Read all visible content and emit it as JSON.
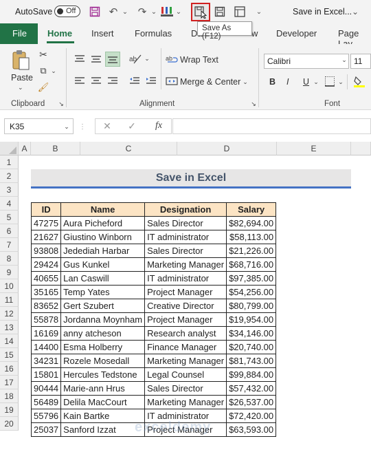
{
  "qat": {
    "autosave_label": "AutoSave",
    "autosave_state": "Off",
    "tooltip": "Save As (F12)",
    "doc_title": "Save in Excel...",
    "icons": [
      "save-icon",
      "undo-icon",
      "redo-icon",
      "paintbrush-icon",
      "save-as-icon",
      "save-icon",
      "print-layout-icon",
      "customize-icon"
    ]
  },
  "tabs": {
    "file": "File",
    "items": [
      "Home",
      "Insert",
      "Formulas",
      "Da",
      "w",
      "Developer",
      "Page Lay"
    ]
  },
  "ribbon": {
    "paste": "Paste",
    "clipboard": "Clipboard",
    "alignment": "Alignment",
    "font_group": "Font",
    "wrap_text": "Wrap Text",
    "merge_center": "Merge & Center",
    "font_name": "Calibri",
    "font_size": "11",
    "bold": "B",
    "italic": "I",
    "underline": "U"
  },
  "formula_bar": {
    "name_box": "K35",
    "fx": "fx",
    "cancel": "✕",
    "enter": "✓"
  },
  "columns": [
    "A",
    "B",
    "C",
    "D",
    "E"
  ],
  "rows": [
    "1",
    "2",
    "3",
    "4",
    "5",
    "6",
    "7",
    "8",
    "9",
    "10",
    "11",
    "12",
    "13",
    "14",
    "15",
    "16",
    "17",
    "18",
    "19",
    "20"
  ],
  "sheet": {
    "title": "Save in Excel",
    "headers": [
      "ID",
      "Name",
      "Designation",
      "Salary"
    ],
    "records": [
      [
        "47275",
        "Aura Picheford",
        "Sales Director",
        "$82,694.00"
      ],
      [
        "21627",
        "Giustino Winborn",
        "IT administrator",
        "$58,113.00"
      ],
      [
        "93808",
        "Jedediah Harbar",
        "Sales Director",
        "$21,226.00"
      ],
      [
        "29424",
        "Gus Kunkel",
        "Marketing Manager",
        "$68,716.00"
      ],
      [
        "40655",
        "Lan Caswill",
        "IT administrator",
        "$97,385.00"
      ],
      [
        "35165",
        "Temp Yates",
        "Project Manager",
        "$54,256.00"
      ],
      [
        "83652",
        "Gert Szubert",
        "Creative Director",
        "$80,799.00"
      ],
      [
        "55878",
        "Jordanna Moynham",
        "Project Manager",
        "$19,954.00"
      ],
      [
        "16169",
        "anny atcheson",
        "Research analyst",
        "$34,146.00"
      ],
      [
        "14400",
        "Esma Holberry",
        "Finance Manager",
        "$20,740.00"
      ],
      [
        "34231",
        "Rozele Mosedall",
        "Marketing Manager",
        "$81,743.00"
      ],
      [
        "15801",
        "Hercules Tedstone",
        "Legal Counsel",
        "$99,884.00"
      ],
      [
        "90444",
        "Marie-ann Hrus",
        "Sales Director",
        "$57,432.00"
      ],
      [
        "56489",
        "Delila MacCourt",
        "Marketing Manager",
        "$26,537.00"
      ],
      [
        "55796",
        "Kain Bartke",
        "IT administrator",
        "$72,420.00"
      ],
      [
        "25037",
        "Sanford Izzat",
        "Project Manager",
        "$63,593.00"
      ]
    ]
  },
  "watermark": "exceldemy"
}
